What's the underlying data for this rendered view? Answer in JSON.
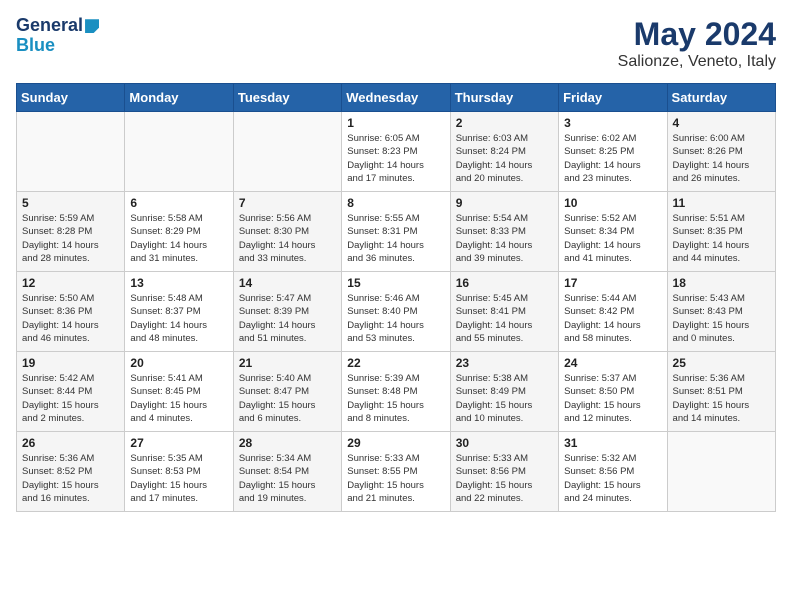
{
  "header": {
    "logo_general": "General",
    "logo_blue": "Blue",
    "month": "May 2024",
    "location": "Salionze, Veneto, Italy"
  },
  "weekdays": [
    "Sunday",
    "Monday",
    "Tuesday",
    "Wednesday",
    "Thursday",
    "Friday",
    "Saturday"
  ],
  "weeks": [
    [
      {
        "day": "",
        "info": ""
      },
      {
        "day": "",
        "info": ""
      },
      {
        "day": "",
        "info": ""
      },
      {
        "day": "1",
        "info": "Sunrise: 6:05 AM\nSunset: 8:23 PM\nDaylight: 14 hours\nand 17 minutes."
      },
      {
        "day": "2",
        "info": "Sunrise: 6:03 AM\nSunset: 8:24 PM\nDaylight: 14 hours\nand 20 minutes."
      },
      {
        "day": "3",
        "info": "Sunrise: 6:02 AM\nSunset: 8:25 PM\nDaylight: 14 hours\nand 23 minutes."
      },
      {
        "day": "4",
        "info": "Sunrise: 6:00 AM\nSunset: 8:26 PM\nDaylight: 14 hours\nand 26 minutes."
      }
    ],
    [
      {
        "day": "5",
        "info": "Sunrise: 5:59 AM\nSunset: 8:28 PM\nDaylight: 14 hours\nand 28 minutes."
      },
      {
        "day": "6",
        "info": "Sunrise: 5:58 AM\nSunset: 8:29 PM\nDaylight: 14 hours\nand 31 minutes."
      },
      {
        "day": "7",
        "info": "Sunrise: 5:56 AM\nSunset: 8:30 PM\nDaylight: 14 hours\nand 33 minutes."
      },
      {
        "day": "8",
        "info": "Sunrise: 5:55 AM\nSunset: 8:31 PM\nDaylight: 14 hours\nand 36 minutes."
      },
      {
        "day": "9",
        "info": "Sunrise: 5:54 AM\nSunset: 8:33 PM\nDaylight: 14 hours\nand 39 minutes."
      },
      {
        "day": "10",
        "info": "Sunrise: 5:52 AM\nSunset: 8:34 PM\nDaylight: 14 hours\nand 41 minutes."
      },
      {
        "day": "11",
        "info": "Sunrise: 5:51 AM\nSunset: 8:35 PM\nDaylight: 14 hours\nand 44 minutes."
      }
    ],
    [
      {
        "day": "12",
        "info": "Sunrise: 5:50 AM\nSunset: 8:36 PM\nDaylight: 14 hours\nand 46 minutes."
      },
      {
        "day": "13",
        "info": "Sunrise: 5:48 AM\nSunset: 8:37 PM\nDaylight: 14 hours\nand 48 minutes."
      },
      {
        "day": "14",
        "info": "Sunrise: 5:47 AM\nSunset: 8:39 PM\nDaylight: 14 hours\nand 51 minutes."
      },
      {
        "day": "15",
        "info": "Sunrise: 5:46 AM\nSunset: 8:40 PM\nDaylight: 14 hours\nand 53 minutes."
      },
      {
        "day": "16",
        "info": "Sunrise: 5:45 AM\nSunset: 8:41 PM\nDaylight: 14 hours\nand 55 minutes."
      },
      {
        "day": "17",
        "info": "Sunrise: 5:44 AM\nSunset: 8:42 PM\nDaylight: 14 hours\nand 58 minutes."
      },
      {
        "day": "18",
        "info": "Sunrise: 5:43 AM\nSunset: 8:43 PM\nDaylight: 15 hours\nand 0 minutes."
      }
    ],
    [
      {
        "day": "19",
        "info": "Sunrise: 5:42 AM\nSunset: 8:44 PM\nDaylight: 15 hours\nand 2 minutes."
      },
      {
        "day": "20",
        "info": "Sunrise: 5:41 AM\nSunset: 8:45 PM\nDaylight: 15 hours\nand 4 minutes."
      },
      {
        "day": "21",
        "info": "Sunrise: 5:40 AM\nSunset: 8:47 PM\nDaylight: 15 hours\nand 6 minutes."
      },
      {
        "day": "22",
        "info": "Sunrise: 5:39 AM\nSunset: 8:48 PM\nDaylight: 15 hours\nand 8 minutes."
      },
      {
        "day": "23",
        "info": "Sunrise: 5:38 AM\nSunset: 8:49 PM\nDaylight: 15 hours\nand 10 minutes."
      },
      {
        "day": "24",
        "info": "Sunrise: 5:37 AM\nSunset: 8:50 PM\nDaylight: 15 hours\nand 12 minutes."
      },
      {
        "day": "25",
        "info": "Sunrise: 5:36 AM\nSunset: 8:51 PM\nDaylight: 15 hours\nand 14 minutes."
      }
    ],
    [
      {
        "day": "26",
        "info": "Sunrise: 5:36 AM\nSunset: 8:52 PM\nDaylight: 15 hours\nand 16 minutes."
      },
      {
        "day": "27",
        "info": "Sunrise: 5:35 AM\nSunset: 8:53 PM\nDaylight: 15 hours\nand 17 minutes."
      },
      {
        "day": "28",
        "info": "Sunrise: 5:34 AM\nSunset: 8:54 PM\nDaylight: 15 hours\nand 19 minutes."
      },
      {
        "day": "29",
        "info": "Sunrise: 5:33 AM\nSunset: 8:55 PM\nDaylight: 15 hours\nand 21 minutes."
      },
      {
        "day": "30",
        "info": "Sunrise: 5:33 AM\nSunset: 8:56 PM\nDaylight: 15 hours\nand 22 minutes."
      },
      {
        "day": "31",
        "info": "Sunrise: 5:32 AM\nSunset: 8:56 PM\nDaylight: 15 hours\nand 24 minutes."
      },
      {
        "day": "",
        "info": ""
      }
    ]
  ]
}
